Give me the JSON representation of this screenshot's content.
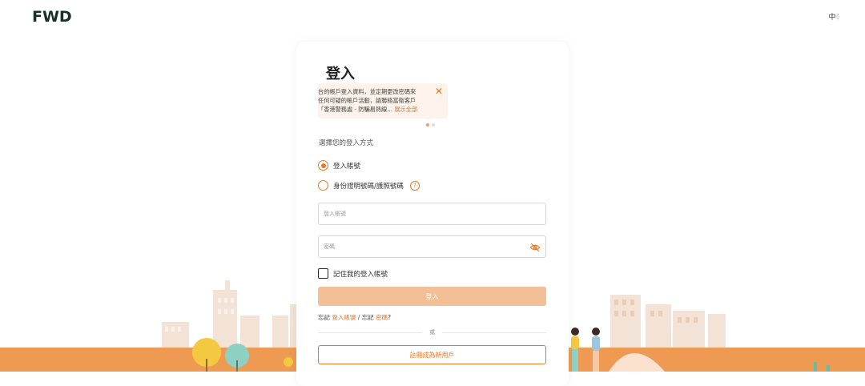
{
  "header": {
    "logo_text": "FWD",
    "language": "中",
    "language_chevron": "◊"
  },
  "login": {
    "title": "登入",
    "notice": {
      "line1": "台的帳戶登入資料，並定期更改密碼來",
      "line2": "任何可疑的帳戶活動，請聯絡富衛客戶",
      "line3": "「香港警務處 - 防騙易熱線...",
      "more_label": "展示全部",
      "close_icon": "close-icon"
    },
    "method_label": "選擇您的登入方式",
    "options": [
      {
        "label": "登入帳號",
        "selected": true
      },
      {
        "label": "身份證明號碼/護照號碼",
        "selected": false
      }
    ],
    "help_icon_text": "?",
    "username": {
      "placeholder": "登入帳號",
      "value": ""
    },
    "password": {
      "placeholder": "密碼",
      "value": ""
    },
    "remember_label": "記住我的登入帳號",
    "login_button": "登入",
    "forgot_prefix": "忘記",
    "forgot_username": "登入帳號",
    "forgot_sep": "/ 忘記",
    "forgot_password": "密碼",
    "forgot_suffix": "?",
    "or_label": "或",
    "register_button": "註冊成為新用戶"
  },
  "colors": {
    "brand_orange": "#e87722",
    "brand_green": "#183028",
    "disabled_button": "#f2bf97",
    "ground": "#ef9a52"
  }
}
